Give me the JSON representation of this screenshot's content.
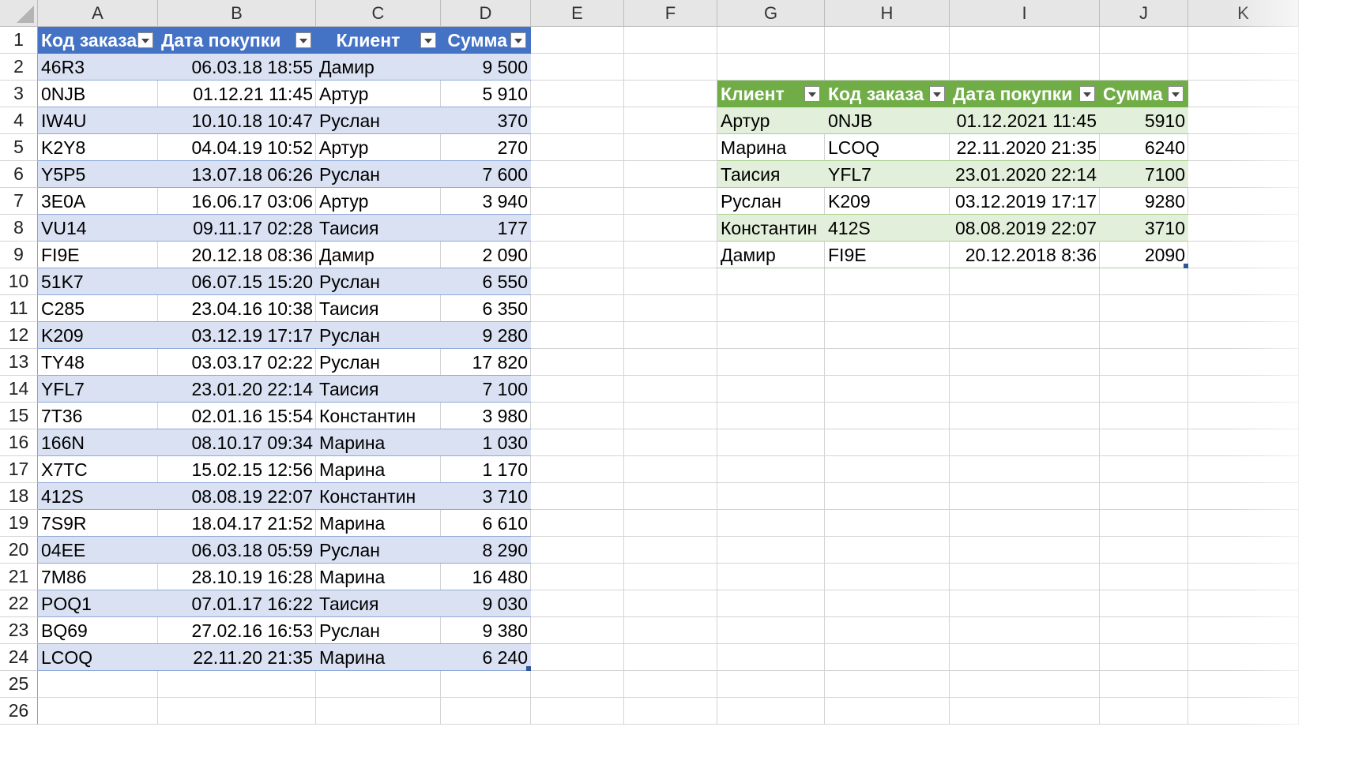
{
  "columns": [
    "A",
    "B",
    "C",
    "D",
    "E",
    "F",
    "G",
    "H",
    "I",
    "J",
    "K"
  ],
  "rows": [
    "1",
    "2",
    "3",
    "4",
    "5",
    "6",
    "7",
    "8",
    "9",
    "10",
    "11",
    "12",
    "13",
    "14",
    "15",
    "16",
    "17",
    "18",
    "19",
    "20",
    "21",
    "22",
    "23",
    "24",
    "25",
    "26"
  ],
  "table1": {
    "headers": [
      "Код заказа",
      "Дата покупки",
      "Клиент",
      "Сумма"
    ],
    "rows": [
      [
        "46R3",
        "06.03.18 18:55",
        "Дамир",
        "9 500"
      ],
      [
        "0NJB",
        "01.12.21 11:45",
        "Артур",
        "5 910"
      ],
      [
        "IW4U",
        "10.10.18 10:47",
        "Руслан",
        "370"
      ],
      [
        "K2Y8",
        "04.04.19 10:52",
        "Артур",
        "270"
      ],
      [
        "Y5P5",
        "13.07.18 06:26",
        "Руслан",
        "7 600"
      ],
      [
        "3E0A",
        "16.06.17 03:06",
        "Артур",
        "3 940"
      ],
      [
        "VU14",
        "09.11.17 02:28",
        "Таисия",
        "177"
      ],
      [
        "FI9E",
        "20.12.18 08:36",
        "Дамир",
        "2 090"
      ],
      [
        "51K7",
        "06.07.15 15:20",
        "Руслан",
        "6 550"
      ],
      [
        "C285",
        "23.04.16 10:38",
        "Таисия",
        "6 350"
      ],
      [
        "K209",
        "03.12.19 17:17",
        "Руслан",
        "9 280"
      ],
      [
        "TY48",
        "03.03.17 02:22",
        "Руслан",
        "17 820"
      ],
      [
        "YFL7",
        "23.01.20 22:14",
        "Таисия",
        "7 100"
      ],
      [
        "7T36",
        "02.01.16 15:54",
        "Константин",
        "3 980"
      ],
      [
        "166N",
        "08.10.17 09:34",
        "Марина",
        "1 030"
      ],
      [
        "X7TC",
        "15.02.15 12:56",
        "Марина",
        "1 170"
      ],
      [
        "412S",
        "08.08.19 22:07",
        "Константин",
        "3 710"
      ],
      [
        "7S9R",
        "18.04.17 21:52",
        "Марина",
        "6 610"
      ],
      [
        "04EE",
        "06.03.18 05:59",
        "Руслан",
        "8 290"
      ],
      [
        "7M86",
        "28.10.19 16:28",
        "Марина",
        "16 480"
      ],
      [
        "POQ1",
        "07.01.17 16:22",
        "Таисия",
        "9 030"
      ],
      [
        "BQ69",
        "27.02.16 16:53",
        "Руслан",
        "9 380"
      ],
      [
        "LCOQ",
        "22.11.20 21:35",
        "Марина",
        "6 240"
      ]
    ]
  },
  "table2": {
    "headers": [
      "Клиент",
      "Код заказа",
      "Дата покупки",
      "Сумма"
    ],
    "rows": [
      [
        "Артур",
        "0NJB",
        "01.12.2021 11:45",
        "5910"
      ],
      [
        "Марина",
        "LCOQ",
        "22.11.2020 21:35",
        "6240"
      ],
      [
        "Таисия",
        "YFL7",
        "23.01.2020 22:14",
        "7100"
      ],
      [
        "Руслан",
        "K209",
        "03.12.2019 17:17",
        "9280"
      ],
      [
        "Константин",
        "412S",
        "08.08.2019 22:07",
        "3710"
      ],
      [
        "Дамир",
        "FI9E",
        "20.12.2018 8:36",
        "2090"
      ]
    ]
  },
  "colors": {
    "table1_header": "#4472c4",
    "table1_band": "#d9e1f2",
    "table2_header": "#70ad47",
    "table2_band": "#e2efda",
    "gridline": "#d4d4d4"
  }
}
